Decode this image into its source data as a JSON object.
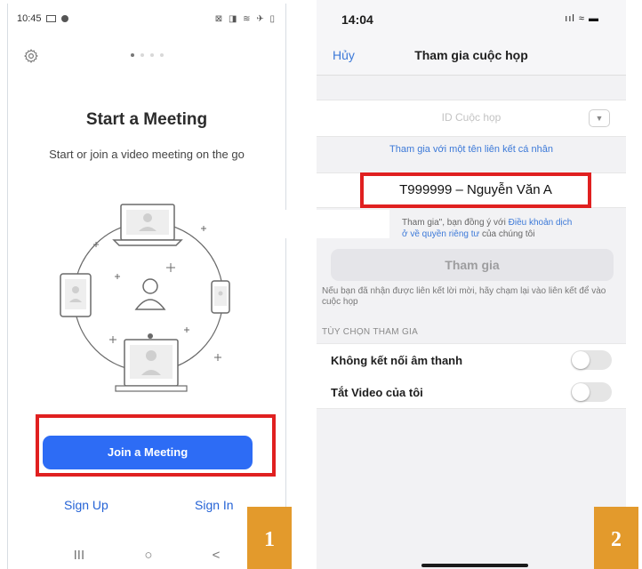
{
  "left": {
    "status": {
      "time": "10:45",
      "icons": "⊠ ◨ ≋ ✈ ▯"
    },
    "title": "Start a Meeting",
    "subtitle": "Start or join a video meeting on the go",
    "join_label": "Join a Meeting",
    "sign_up": "Sign Up",
    "sign_in": "Sign In",
    "nav": {
      "recents": "III",
      "home": "○",
      "back": "<"
    },
    "pager": {
      "count": 4,
      "active": 1
    }
  },
  "right": {
    "status": {
      "time": "14:04",
      "icons": "ııl ≈ ▬"
    },
    "cancel": "Hủy",
    "title": "Tham gia cuộc họp",
    "meeting_id_placeholder": "ID Cuộc họp",
    "dropdown_icon": "chevron-down-icon",
    "personal_link": "Tham gia với một tên liên kết cá nhân",
    "name_value": "T999999 – Nguyễn Văn A",
    "terms_prefix": "Tham gia\", bạn đồng ý với",
    "terms_link1": "Điều khoản dịch",
    "terms_link2": "ở về quyền riêng tư",
    "terms_suffix": "của chúng tôi",
    "join_label": "Tham gia",
    "invite_note": "Nếu bạn đã nhận được liên kết lời mời, hãy chạm lại vào liên kết để vào cuộc họp",
    "options_header": "TÙY CHỌN THAM GIA",
    "options": [
      {
        "label": "Không kết nối âm thanh",
        "on": false
      },
      {
        "label": "Tắt Video của tôi",
        "on": false
      }
    ]
  },
  "badges": [
    "1",
    "2"
  ],
  "colors": {
    "zoom_blue": "#2d6cf5",
    "highlight_red": "#e02020",
    "badge_orange": "#e39a2c",
    "link_blue": "#3c79d8"
  }
}
